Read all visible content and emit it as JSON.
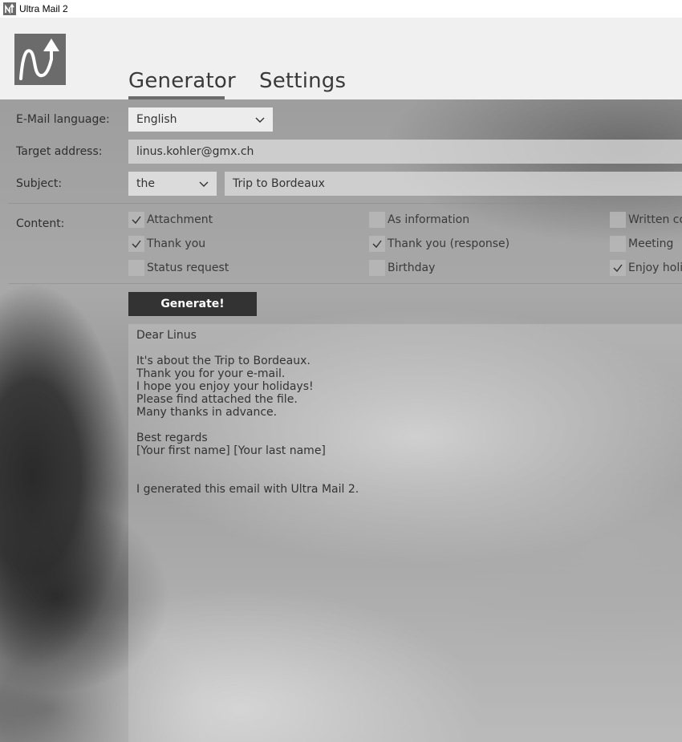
{
  "window": {
    "title": "Ultra Mail 2"
  },
  "tabs": [
    {
      "label": "Generator",
      "active": true
    },
    {
      "label": "Settings",
      "active": false
    }
  ],
  "form": {
    "language_label": "E-Mail language:",
    "language_value": "English",
    "target_label": "Target address:",
    "target_value": "linus.kohler@gmx.ch",
    "subject_label": "Subject:",
    "subject_article": "the",
    "subject_value": "Trip to Bordeaux",
    "content_label": "Content:"
  },
  "content_options": [
    {
      "label": "Attachment",
      "checked": true
    },
    {
      "label": "As information",
      "checked": false
    },
    {
      "label": "Written co",
      "checked": false
    },
    {
      "label": "Thank you",
      "checked": true
    },
    {
      "label": "Thank you (response)",
      "checked": true
    },
    {
      "label": "Meeting",
      "checked": false
    },
    {
      "label": "Status request",
      "checked": false
    },
    {
      "label": "Birthday",
      "checked": false
    },
    {
      "label": "Enjoy holid",
      "checked": true
    }
  ],
  "generate_label": "Generate!",
  "output_lines": [
    "Dear Linus",
    "",
    "It's about the Trip to Bordeaux.",
    "Thank you for your e-mail.",
    "I hope you enjoy your holidays!",
    "Please find attached the file.",
    "Many thanks in advance.",
    "",
    "Best regards",
    "[Your first name] [Your last name]",
    "",
    "",
    "I generated this email with Ultra Mail 2."
  ],
  "colors": {
    "accent": "#6b6b6b",
    "button": "#333333"
  }
}
